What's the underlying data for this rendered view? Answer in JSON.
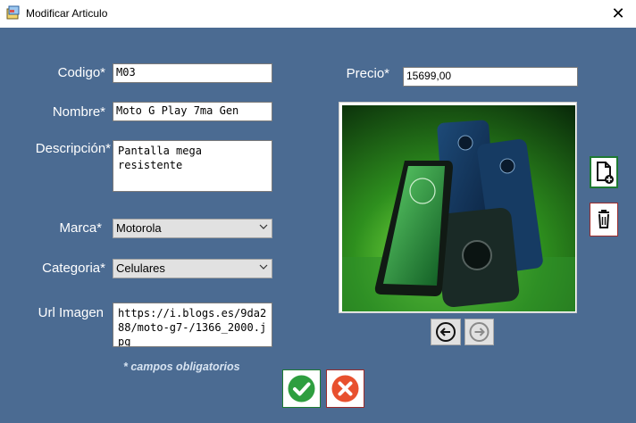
{
  "window": {
    "title": "Modificar Articulo"
  },
  "form": {
    "codigo": {
      "label": "Codigo*",
      "value": "M03"
    },
    "nombre": {
      "label": "Nombre*",
      "value": "Moto G Play 7ma Gen"
    },
    "descripcion": {
      "label": "Descripción*",
      "value": "Pantalla mega resistente"
    },
    "marca": {
      "label": "Marca*",
      "value": "Motorola"
    },
    "categoria": {
      "label": "Categoria*",
      "value": "Celulares"
    },
    "url_imagen": {
      "label": "Url Imagen",
      "value": "https://i.blogs.es/9da288/moto-g7-/1366_2000.jpg"
    },
    "precio": {
      "label": "Precio*",
      "value": "15699,00"
    },
    "required_note": "* campos obligatorios"
  },
  "icons": {
    "title": "app-window-icon",
    "close": "close-icon",
    "add_image": "file-add-icon",
    "delete_image": "trash-icon",
    "prev": "arrow-left-icon",
    "next": "arrow-right-icon",
    "accept": "checkmark-icon",
    "cancel": "x-cancel-icon"
  },
  "colors": {
    "background": "#4b6b92",
    "accept_green": "#2e9e3f",
    "cancel_red": "#e8502e",
    "add_border": "#1e7a32",
    "delete_border": "#9b2b2b"
  }
}
